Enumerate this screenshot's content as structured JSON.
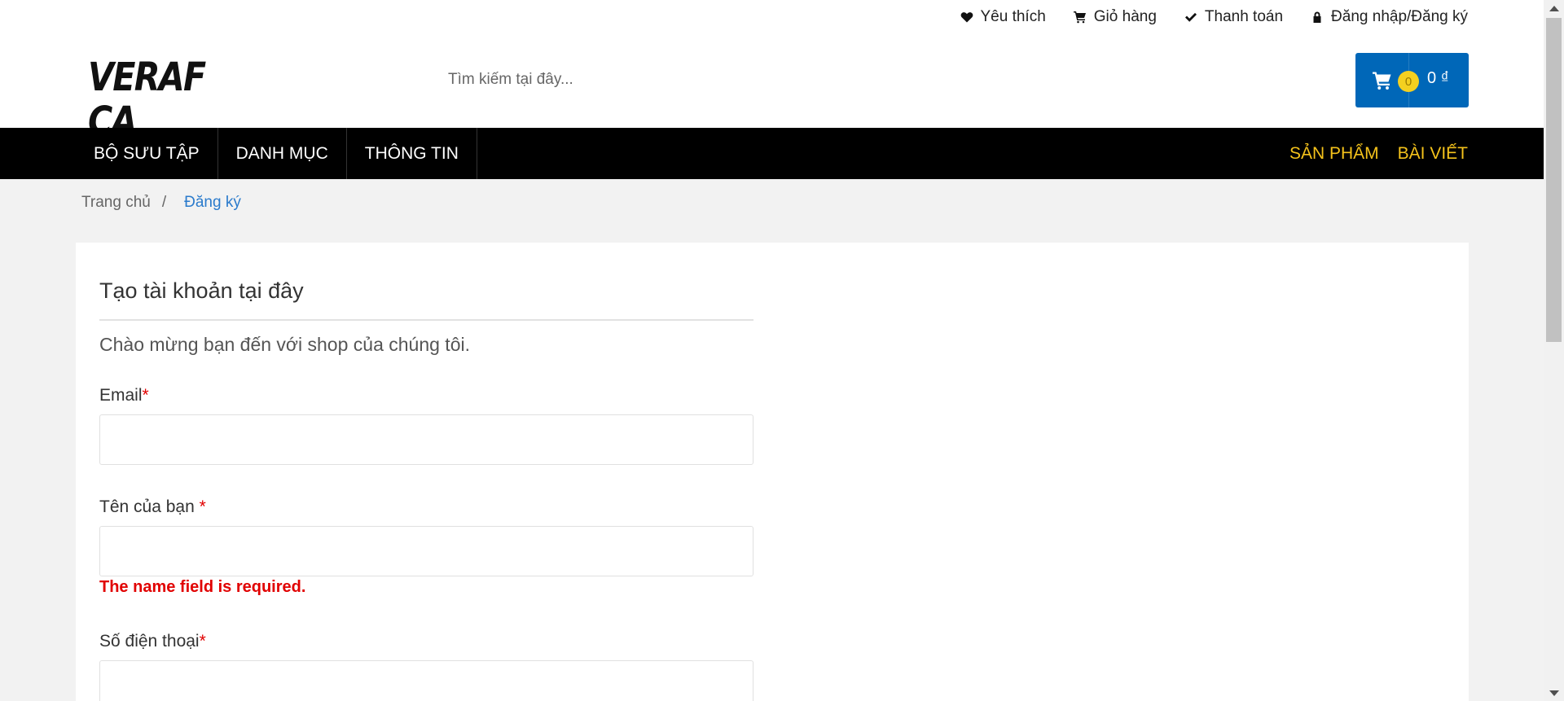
{
  "header": {
    "top_links": [
      {
        "icon": "heart-icon",
        "label": "Yêu thích"
      },
      {
        "icon": "cart-icon",
        "label": "Giỏ hàng"
      },
      {
        "icon": "check-icon",
        "label": "Thanh toán"
      },
      {
        "icon": "lock-icon",
        "label": "Đăng nhập/Đăng ký"
      }
    ],
    "logo_text": "VERAF CA",
    "search_placeholder": "Tìm kiếm tại đây...",
    "cart": {
      "count": "0",
      "total": "0 ₫"
    }
  },
  "nav": {
    "left": [
      "BỘ SƯU TẬP",
      "DANH MỤC",
      "THÔNG TIN"
    ],
    "right": [
      "SẢN PHẨM",
      "BÀI VIẾT"
    ],
    "right_color": "#f4c21b"
  },
  "breadcrumb": {
    "home": "Trang chủ",
    "separator": "/",
    "current": "Đăng ký"
  },
  "form": {
    "title": "Tạo tài khoản tại đây",
    "welcome": "Chào mừng bạn đến với shop của chúng tôi.",
    "fields": [
      {
        "label": "Email",
        "required_mark": "*",
        "value": ""
      },
      {
        "label": "Tên của bạn ",
        "required_mark": "*",
        "value": "",
        "error": "The name field is required."
      },
      {
        "label": "Số điện thoại",
        "required_mark": "*",
        "value": ""
      }
    ]
  },
  "colors": {
    "accent": "#0067b8",
    "error": "#e10000",
    "nav_bg": "#000000",
    "link": "#2b7bcc"
  }
}
